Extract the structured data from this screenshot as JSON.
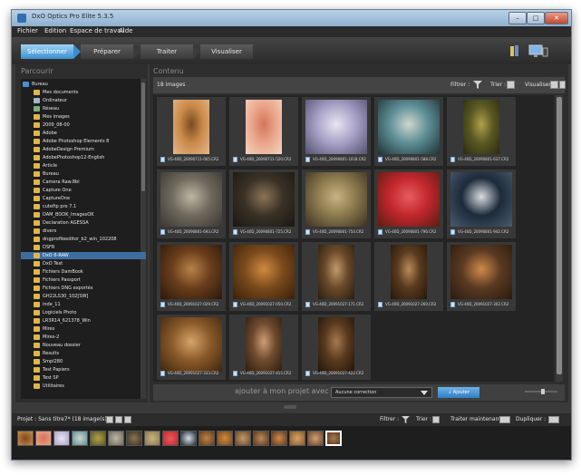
{
  "window": {
    "title": "DxO Optics Pro Elite 5.3.5",
    "controls": [
      "–",
      "□",
      "✕"
    ]
  },
  "menu": [
    "Fichier",
    "Edition",
    "Espace de travail",
    "Aide"
  ],
  "modes": [
    {
      "label": "Sélectionner",
      "active": true
    },
    {
      "label": "Préparer",
      "active": false
    },
    {
      "label": "Traiter",
      "active": false
    },
    {
      "label": "Visualiser",
      "active": false
    }
  ],
  "left_panel": {
    "title": "Parcourir",
    "tree": [
      {
        "label": "Bureau",
        "level": 0,
        "selected": false,
        "type": "desktop"
      },
      {
        "label": "Mes documents",
        "level": 1,
        "selected": false,
        "type": "folder"
      },
      {
        "label": "Ordinateur",
        "level": 1,
        "selected": false,
        "type": "computer"
      },
      {
        "label": "Réseau",
        "level": 1,
        "selected": false,
        "type": "network"
      },
      {
        "label": "Mes images",
        "level": 1,
        "selected": false,
        "type": "folder"
      },
      {
        "label": "2009_08-00",
        "level": 1,
        "selected": false,
        "type": "folder"
      },
      {
        "label": "Adobe",
        "level": 1,
        "selected": false,
        "type": "folder"
      },
      {
        "label": "Adobe Photoshop Elements 8",
        "level": 1,
        "selected": false,
        "type": "folder"
      },
      {
        "label": "AdobeDesign Premium",
        "level": 1,
        "selected": false,
        "type": "folder"
      },
      {
        "label": "AdobePhotoshop12-English",
        "level": 1,
        "selected": false,
        "type": "folder"
      },
      {
        "label": "Article",
        "level": 1,
        "selected": false,
        "type": "folder"
      },
      {
        "label": "Bureau",
        "level": 1,
        "selected": false,
        "type": "folder"
      },
      {
        "label": "Camera Raw.8bi",
        "level": 1,
        "selected": false,
        "type": "folder"
      },
      {
        "label": "Capture One",
        "level": 1,
        "selected": false,
        "type": "folder"
      },
      {
        "label": "CaptureOne",
        "level": 1,
        "selected": false,
        "type": "folder"
      },
      {
        "label": "cuteftp pro 7.1",
        "level": 1,
        "selected": false,
        "type": "folder"
      },
      {
        "label": "DAM_BOOK_ImagesOK",
        "level": 1,
        "selected": false,
        "type": "folder"
      },
      {
        "label": "Declaration AGESSA",
        "level": 1,
        "selected": false,
        "type": "folder"
      },
      {
        "label": "divers",
        "level": 1,
        "selected": false,
        "type": "folder"
      },
      {
        "label": "dngprofileeditor_b2_win_102208",
        "level": 1,
        "selected": false,
        "type": "folder"
      },
      {
        "label": "DSFR",
        "level": 1,
        "selected": false,
        "type": "folder"
      },
      {
        "label": "DxO 6-RAW",
        "level": 1,
        "selected": true,
        "type": "folder"
      },
      {
        "label": "DxO Test",
        "level": 1,
        "selected": false,
        "type": "folder"
      },
      {
        "label": "Fichiers DamBook",
        "level": 1,
        "selected": false,
        "type": "folder"
      },
      {
        "label": "Fichiers Passport",
        "level": 1,
        "selected": false,
        "type": "folder"
      },
      {
        "label": "Fichiers DNG exportés",
        "level": 1,
        "selected": false,
        "type": "folder"
      },
      {
        "label": "GH22LS30_102[SW]",
        "level": 1,
        "selected": false,
        "type": "folder"
      },
      {
        "label": "inde_11",
        "level": 1,
        "selected": false,
        "type": "folder"
      },
      {
        "label": "Logiciels Photo",
        "level": 1,
        "selected": false,
        "type": "folder"
      },
      {
        "label": "LR3R14_621378_Win",
        "level": 1,
        "selected": false,
        "type": "folder"
      },
      {
        "label": "Mires",
        "level": 1,
        "selected": false,
        "type": "folder"
      },
      {
        "label": "Mires-2",
        "level": 1,
        "selected": false,
        "type": "folder"
      },
      {
        "label": "Nouveau dossier",
        "level": 1,
        "selected": false,
        "type": "folder"
      },
      {
        "label": "Results",
        "level": 1,
        "selected": false,
        "type": "folder"
      },
      {
        "label": "Smpl280",
        "level": 1,
        "selected": false,
        "type": "folder"
      },
      {
        "label": "Test Papiers",
        "level": 1,
        "selected": false,
        "type": "folder"
      },
      {
        "label": "Test SP",
        "level": 1,
        "selected": false,
        "type": "folder"
      },
      {
        "label": "Utilitaires",
        "level": 1,
        "selected": false,
        "type": "folder"
      }
    ]
  },
  "content": {
    "title": "Contenu",
    "count_label": "18 images",
    "filter_label": "Filtrer :",
    "sort_label": "Trier :",
    "view_label": "Visualiser :",
    "images": [
      {
        "name": "VG-40D_20090711-065.CR2",
        "colors": [
          "#c98a4a",
          "#7a4a1e",
          "#e7b68a"
        ]
      },
      {
        "name": "VG-40D_20090711-520.CR2",
        "colors": [
          "#e9a58a",
          "#d4745a",
          "#f6d2c1"
        ]
      },
      {
        "name": "VG-40D_20090801-1018.CR2",
        "colors": [
          "#a9a3c8",
          "#e9e5ef",
          "#53506e"
        ]
      },
      {
        "name": "VG-40D_20090801-588.CR2",
        "colors": [
          "#5d8f96",
          "#cfd6cf",
          "#203236"
        ]
      },
      {
        "name": "VG-40D_20090801-637.CR2",
        "colors": [
          "#5a5a22",
          "#b1a04c",
          "#2b2a12"
        ]
      },
      {
        "name": "VG-40D_20090801-693.CR2",
        "colors": [
          "#6f6a5e",
          "#bdb6a3",
          "#3a3630"
        ]
      },
      {
        "name": "VG-40D_20090801-725.CR2",
        "colors": [
          "#3b3226",
          "#8b7456",
          "#1a1712"
        ]
      },
      {
        "name": "VG-40D_20090801-754.CR2",
        "colors": [
          "#8c7a4e",
          "#c8b483",
          "#3a3121"
        ]
      },
      {
        "name": "VG-40D_20090801-796.CR2",
        "colors": [
          "#c2272d",
          "#e85c5e",
          "#5b1d12"
        ]
      },
      {
        "name": "VG-40D_20090801-942.CR2",
        "colors": [
          "#1c2a3a",
          "#d9dde2",
          "#4a5b6e"
        ]
      },
      {
        "name": "VG-40D_20091027-029.CR2",
        "colors": [
          "#6a3e1c",
          "#b98148",
          "#2a180b"
        ]
      },
      {
        "name": "VG-40D_20091027-050.CR2",
        "colors": [
          "#7a4a1c",
          "#d08a3e",
          "#3a2009"
        ]
      },
      {
        "name": "VG-40D_20091027-171.CR2",
        "colors": [
          "#6a4a2a",
          "#c29a6a",
          "#2a1d10"
        ]
      },
      {
        "name": "VG-40D_20091027-260.CR2",
        "colors": [
          "#5a3a1e",
          "#b98a5a",
          "#24170c"
        ]
      },
      {
        "name": "VG-40D_20091027-302.CR2",
        "colors": [
          "#5a3a22",
          "#cf8a4a",
          "#2a1a0e"
        ]
      },
      {
        "name": "VG-40D_20091027-333.CR2",
        "colors": [
          "#8a5a2a",
          "#d5a46a",
          "#3e250f"
        ]
      },
      {
        "name": "VG-40D_20091027-415.CR2",
        "colors": [
          "#6e4a2e",
          "#cc9e74",
          "#2d1d10"
        ]
      },
      {
        "name": "VG-40D_20091027-422.CR2",
        "colors": [
          "#5a3a1e",
          "#a67a4e",
          "#20150a"
        ]
      }
    ]
  },
  "add_bar": {
    "label": "ajouter à mon projet avec :",
    "combo_value": "Aucune correction",
    "button_label": "↓ Ajouter"
  },
  "project_bar": {
    "project_label": "Projet : Sans titre7* (18 image(s))",
    "filter_label": "Filtrer :",
    "sort_label": "Trier :",
    "process_label": "Traiter maintenant :",
    "duplicate_label": "Dupliquer :"
  },
  "colors": {
    "accent": "#3a8fd0",
    "background": "#2e2e2e",
    "selection": "#3d6ea1",
    "folder": "#e0b64a"
  }
}
